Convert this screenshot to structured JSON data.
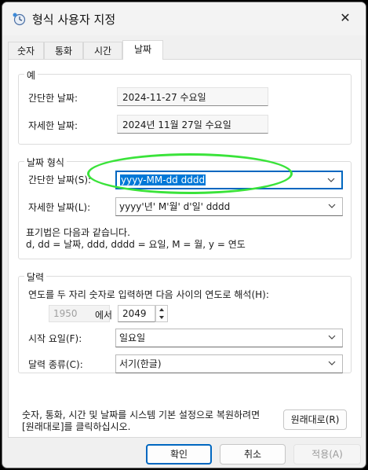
{
  "window": {
    "title": "형식 사용자 지정",
    "close_glyph": "✕"
  },
  "tabs": [
    "숫자",
    "통화",
    "시간",
    "날짜"
  ],
  "example": {
    "legend": "예",
    "short_label": "간단한 날짜:",
    "short_value": "2024-11-27 수요일",
    "long_label": "자세한 날짜:",
    "long_value": "2024년 11월 27일 수요일"
  },
  "date_format": {
    "legend": "날짜 형식",
    "short_label": "간단한 날짜(S):",
    "short_value": "yyyy-MM-dd dddd",
    "long_label": "자세한 날짜(L):",
    "long_value": "yyyy'년' M'월' d'일' dddd",
    "notation_line1": "표기법은 다음과 같습니다.",
    "notation_line2": "d, dd = 날짜,  ddd, dddd = 요일,  M = 월,  y = 연도"
  },
  "calendar": {
    "legend": "달력",
    "two_digit_text": "연도를 두 자리 숫자로 입력하면 다음 사이의 연도로 해석(H):",
    "from_year": "1950",
    "to_word": "에서",
    "to_year": "2049",
    "first_day_label": "시작 요일(F):",
    "first_day_value": "일요일",
    "calendar_type_label": "달력 종류(C):",
    "calendar_type_value": "서기(한글)"
  },
  "reset": {
    "text_line1": "숫자, 통화, 시간 및 날짜를 시스템 기본 설정으로 복원하려면",
    "text_line2": "[원래대로]를 클릭하십시오.",
    "button": "원래대로(R)"
  },
  "buttons": {
    "ok": "확인",
    "cancel": "취소",
    "apply": "적용(A)"
  },
  "colors": {
    "accent": "#0067c0",
    "selection": "#0078d7",
    "highlight_ellipse": "#3ae33a"
  }
}
